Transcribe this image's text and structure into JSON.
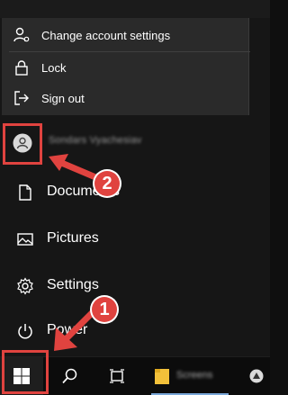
{
  "account_menu": {
    "items": [
      {
        "label": "Change account settings",
        "icon": "account-settings-icon"
      },
      {
        "label": "Lock",
        "icon": "lock-icon"
      },
      {
        "label": "Sign out",
        "icon": "sign-out-icon"
      }
    ]
  },
  "user": {
    "name": "Sondars Vyachesiav",
    "icon": "user-avatar-icon"
  },
  "nav": {
    "documents": "Documents",
    "pictures": "Pictures",
    "settings": "Settings",
    "power": "Power"
  },
  "taskbar": {
    "start_icon": "windows-logo-icon",
    "search_icon": "search-icon",
    "task_view_icon": "task-view-icon",
    "folder_label": "Screens"
  },
  "annotations": {
    "badge_1": "1",
    "badge_2": "2",
    "highlight_color": "#e0433f"
  }
}
